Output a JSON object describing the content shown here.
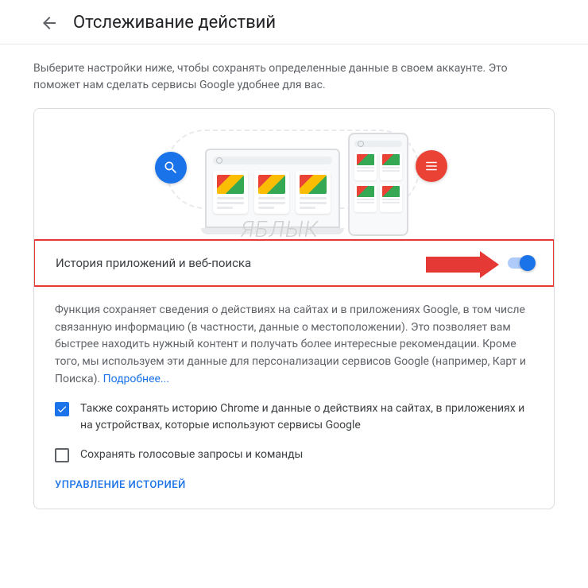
{
  "header": {
    "title": "Отслеживание действий"
  },
  "intro": "Выберите настройки ниже, чтобы сохранять определенные данные в своем аккаунте. Это поможет нам сделать сервисы Google удобнее для вас.",
  "section": {
    "toggle_label": "История приложений и веб-поиска",
    "toggle_on": true,
    "description_text": "Функция сохраняет сведения о действиях на сайтах и в приложениях Google, в том числе связанную информацию (в частности, данные о местоположении). Это позволяет вам быстрее находить нужный контент и получать более интересные рекомендации. Кроме того, мы используем эти данные для персонализации сервисов Google (например, Карт и Поиска). ",
    "learn_more": "Подробнее...",
    "checkboxes": [
      {
        "checked": true,
        "label": "Также сохранять историю Chrome и данные о действиях на сайтах, в приложениях и на устройствах, которые используют сервисы Google"
      },
      {
        "checked": false,
        "label": "Сохранять голосовые запросы и команды"
      }
    ],
    "manage_history": "УПРАВЛЕНИЕ ИСТОРИЕЙ"
  },
  "watermark": "ЯБЛЫК"
}
